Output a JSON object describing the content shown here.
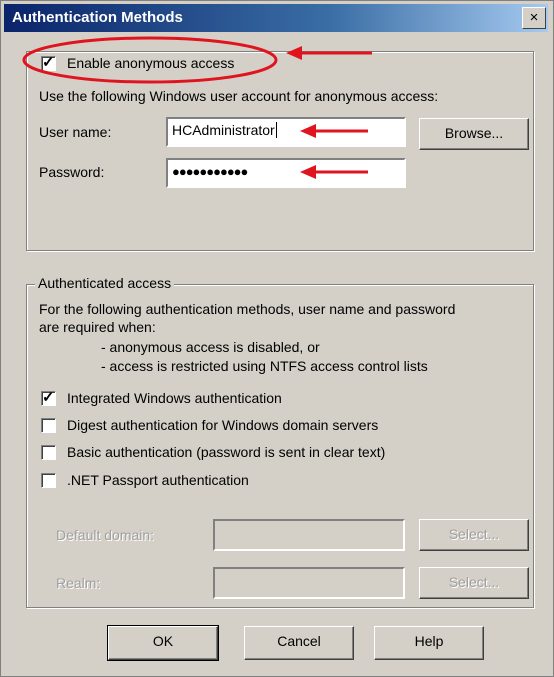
{
  "window": {
    "title": "Authentication Methods",
    "close_label": "×"
  },
  "anonymous": {
    "checkbox_label": "Enable anonymous access",
    "checked": true,
    "description": "Use the following Windows user account for anonymous access:",
    "username_label": "User name:",
    "username_value": "HCAdministrator",
    "password_label": "Password:",
    "password_value": "●●●●●●●●●●●",
    "browse_label": "Browse..."
  },
  "authenticated": {
    "legend": "Authenticated access",
    "description_line1": "For the following authentication methods, user name and password",
    "description_line2": "are required when:",
    "bullet1": "- anonymous access is disabled, or",
    "bullet2": "- access is restricted using NTFS access control lists",
    "options": [
      {
        "label": "Integrated Windows authentication",
        "checked": true
      },
      {
        "label": "Digest authentication for Windows domain servers",
        "checked": false
      },
      {
        "label": "Basic authentication (password is sent in clear text)",
        "checked": false
      },
      {
        "label": ".NET Passport authentication",
        "checked": false
      }
    ],
    "default_domain_label": "Default domain:",
    "realm_label": "Realm:",
    "select_label": "Select..."
  },
  "footer": {
    "ok_label": "OK",
    "cancel_label": "Cancel",
    "help_label": "Help"
  },
  "annotation_color": "#e0141e"
}
